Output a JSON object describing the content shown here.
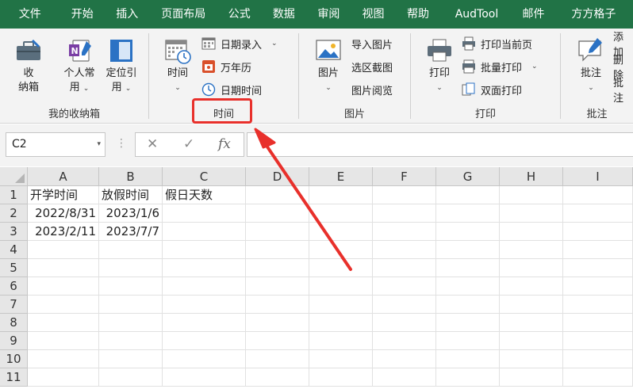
{
  "menu_tabs": [
    "文件",
    "开始",
    "插入",
    "页面布局",
    "公式",
    "数据",
    "审阅",
    "视图",
    "帮助",
    "AudTool",
    "邮件",
    "方方格子"
  ],
  "ribbon": {
    "group_storage": {
      "label": "我的收纳箱",
      "btn_box_line1": "收",
      "btn_box_line2": "纳箱",
      "btn_personal_line1": "个人常",
      "btn_personal_line2": "用",
      "btn_locate_line1": "定位引",
      "btn_locate_line2": "用"
    },
    "group_time": {
      "label": "时间",
      "btn_time": "时间",
      "date_entry": "日期录入",
      "calendar": "万年历",
      "datetime": "日期时间"
    },
    "group_picture": {
      "label": "图片",
      "btn_picture": "图片",
      "import": "导入图片",
      "screenshot": "选区截图",
      "browse": "图片阅览"
    },
    "group_print": {
      "label": "打印",
      "btn_print": "打印",
      "print_current": "打印当前页",
      "batch_print": "批量打印",
      "duplex": "双面打印"
    },
    "group_comment": {
      "label": "批注",
      "btn_comment": "批注",
      "add": "添加",
      "delete": "删除",
      "more": "批注"
    }
  },
  "formula_bar": {
    "name_box": "C2",
    "cancel_glyph": "✕",
    "enter_glyph": "✓",
    "fx_glyph": "fx",
    "formula": ""
  },
  "sheet": {
    "columns": [
      "A",
      "B",
      "C",
      "D",
      "E",
      "F",
      "G",
      "H",
      "I"
    ],
    "rows": [
      "1",
      "2",
      "3",
      "4",
      "5",
      "6",
      "7",
      "8",
      "9",
      "10",
      "11"
    ],
    "cells": {
      "A1": "开学时间",
      "B1": "放假时间",
      "C1": "假日天数",
      "A2": "2022/8/31",
      "B2": "2023/1/6",
      "A3": "2023/2/11",
      "B3": "2023/7/7"
    }
  },
  "colors": {
    "accent": "#217346",
    "annotation": "#e8302b"
  }
}
